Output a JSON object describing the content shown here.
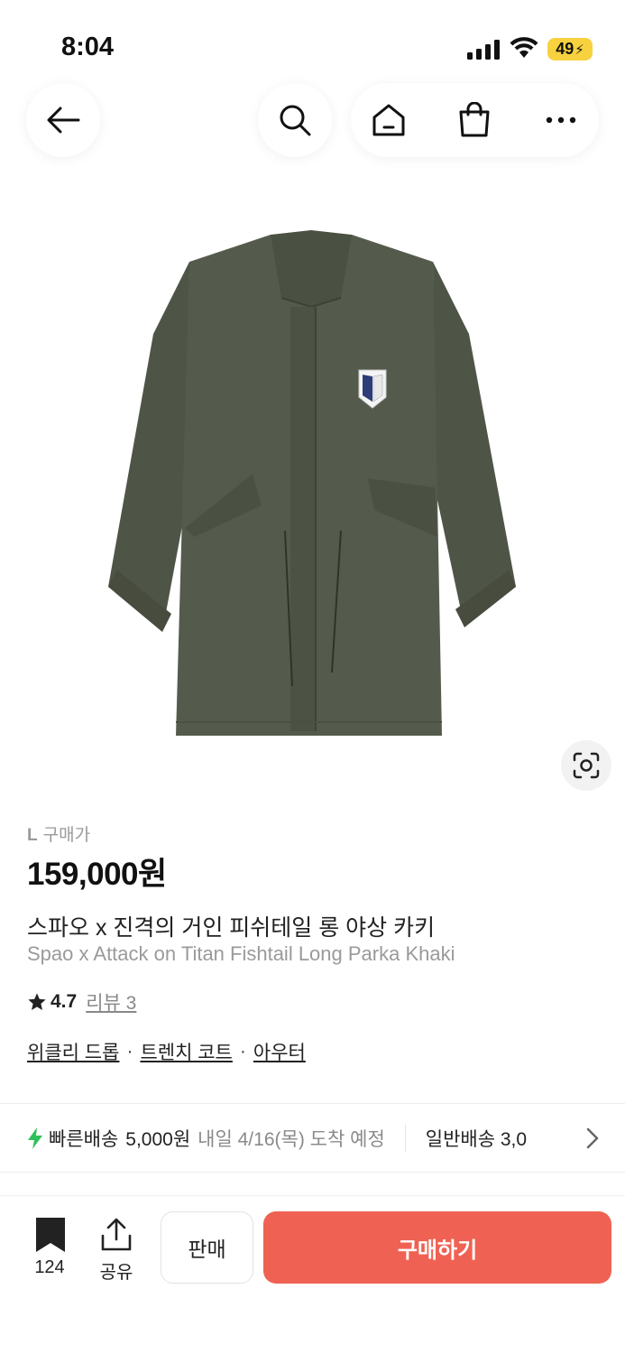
{
  "status_bar": {
    "time": "8:04",
    "battery": "49"
  },
  "nav": {
    "icons": [
      "back-arrow-icon",
      "search-icon",
      "home-icon",
      "shopping-bag-icon",
      "more-icon"
    ]
  },
  "product": {
    "size_prefix": "L",
    "size_label": "구매가",
    "price": "159,000원",
    "title_ko": "스파오 x 진격의 거인 피쉬테일 롱 야상 카키",
    "title_en": "Spao x Attack on Titan Fishtail Long Parka Khaki",
    "rating": "4.7",
    "review_label": "리뷰 3",
    "categories": [
      "위클리 드롭",
      "트렌치 코트",
      "아우터"
    ],
    "category_separator": "·"
  },
  "delivery": {
    "fast_label": "빠른배송",
    "fast_fee": "5,000원",
    "fast_eta": "내일 4/16(목) 도착 예정",
    "standard_label": "일반배송 3,0"
  },
  "bottom_bar": {
    "bookmark_count": "124",
    "share_label": "공유",
    "sell_label": "판매",
    "buy_label": "구매하기"
  },
  "colors": {
    "accent": "#ef6253",
    "product_khaki": "#545a4b",
    "fast_delivery": "#2ec15a"
  }
}
